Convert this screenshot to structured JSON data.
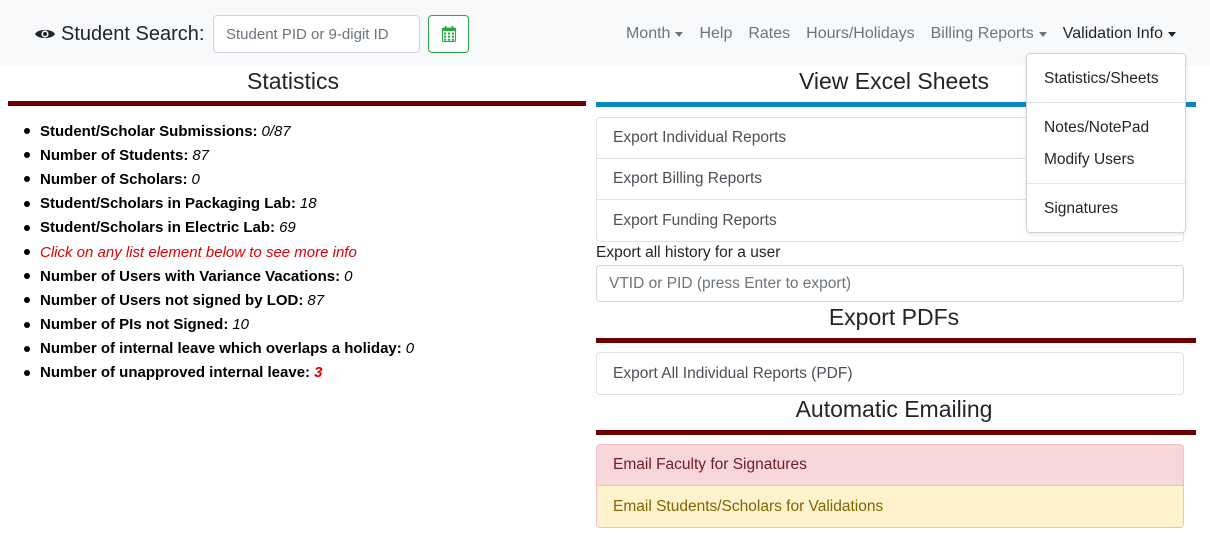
{
  "navbar": {
    "brand_label": "Student Search:",
    "search_placeholder": "Student PID or 9-digit ID",
    "links": {
      "month": "Month",
      "help": "Help",
      "rates": "Rates",
      "hours_holidays": "Hours/Holidays",
      "billing_reports": "Billing Reports",
      "validation_info": "Validation Info"
    }
  },
  "validation_dropdown": {
    "items": [
      "Statistics/Sheets",
      "Notes/NotePad",
      "Modify Users",
      "Signatures"
    ]
  },
  "statistics": {
    "title": "Statistics",
    "items": [
      {
        "label": "Student/Scholar Submissions:",
        "value": "0/87"
      },
      {
        "label": "Number of Students:",
        "value": "87"
      },
      {
        "label": "Number of Scholars:",
        "value": "0"
      },
      {
        "label": "Student/Scholars in Packaging Lab:",
        "value": "18"
      },
      {
        "label": "Student/Scholars in Electric Lab:",
        "value": "69"
      }
    ],
    "info_text": "Click on any list element below to see more info",
    "items2": [
      {
        "label": "Number of Users with Variance Vacations:",
        "value": "0"
      },
      {
        "label": "Number of Users not signed by LOD:",
        "value": "87"
      },
      {
        "label": "Number of PIs not Signed:",
        "value": "10"
      },
      {
        "label": "Number of internal leave which overlaps a holiday:",
        "value": "0"
      },
      {
        "label": "Number of unapproved internal leave:",
        "value": "3"
      }
    ]
  },
  "excel": {
    "title": "View Excel Sheets",
    "items": [
      "Export Individual Reports",
      "Export Billing Reports",
      "Export Funding Reports"
    ],
    "history_label": "Export all history for a user",
    "history_placeholder": "VTID or PID (press Enter to export)"
  },
  "pdfs": {
    "title": "Export PDFs",
    "items": [
      "Export All Individual Reports (PDF)"
    ]
  },
  "emailing": {
    "title": "Automatic Emailing",
    "faculty": "Email Faculty for Signatures",
    "students": "Email Students/Scholars for Validations"
  },
  "colors": {
    "maroon": "#6b0000",
    "blue": "#0a86bf",
    "green": "#28a745",
    "danger_bg": "#f8d7da",
    "warning_bg": "#fff3cd",
    "info_red": "#e00000"
  },
  "icons": {
    "brand": "eye-icon",
    "calendar": "calendar-icon"
  }
}
